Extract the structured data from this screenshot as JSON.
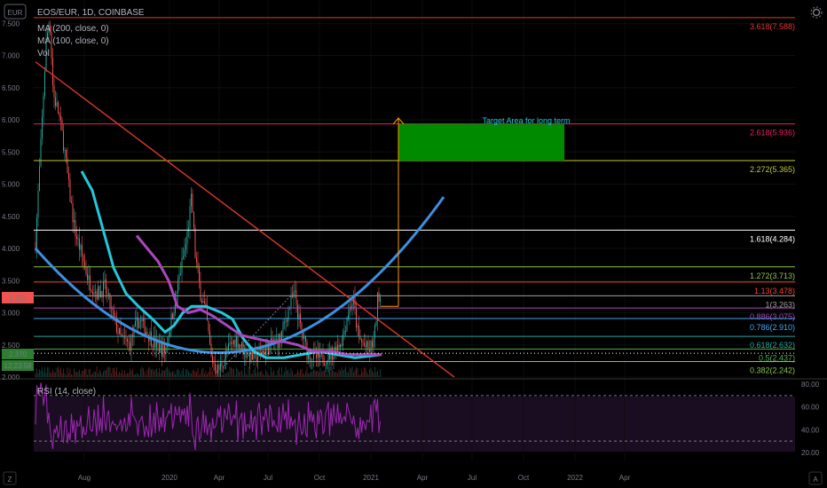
{
  "chart_data": {
    "type": "candlestick",
    "symbol_label": "EOS/EUR, 1D, COINBASE",
    "currency_badge": "EUR",
    "indicators": [
      "MA (200, close, 0)",
      "MA (100, close, 0)",
      "Vol"
    ],
    "rsi_label": "RSI (14, close)",
    "current_price": "3.258",
    "price_tag_2": "2.370",
    "countdown": "12:23:58",
    "price_axis": {
      "ticks": [
        "7.500",
        "7.000",
        "6.500",
        "6.000",
        "5.500",
        "5.000",
        "4.500",
        "4.000",
        "3.500",
        "3.000",
        "2.500",
        "2.000"
      ],
      "values": [
        7.5,
        7.0,
        6.5,
        6.0,
        5.5,
        5.0,
        4.5,
        4.0,
        3.5,
        3.0,
        2.5,
        2.0
      ],
      "ylim": [
        2.0,
        7.5
      ]
    },
    "rsi_axis": {
      "ticks": [
        "80.00",
        "60.00",
        "40.00",
        "20.00"
      ],
      "values": [
        80,
        60,
        40,
        20
      ],
      "ylim": [
        20,
        80
      ],
      "bands": [
        70,
        30
      ]
    },
    "time_axis": [
      "Aug",
      "2020",
      "Apr",
      "Jul",
      "Oct",
      "2021",
      "Apr",
      "Jul",
      "Oct",
      "2022",
      "Apr"
    ],
    "fib_levels": [
      {
        "label": "3.618(7.588)",
        "value": 7.588,
        "color": "#e0362f"
      },
      {
        "label": "2.618(5.936)",
        "value": 5.936,
        "color": "#e91e63"
      },
      {
        "label": "2.272(5.365)",
        "value": 5.365,
        "color": "#c0ca33"
      },
      {
        "label": "1.618(4.284)",
        "value": 4.284,
        "color": "#ffffff"
      },
      {
        "label": "1.272(3.713)",
        "value": 3.713,
        "color": "#8bc34a"
      },
      {
        "label": "1.13(3.478)",
        "value": 3.478,
        "color": "#f44336"
      },
      {
        "label": "1(3.263)",
        "value": 3.263,
        "color": "#9e9e9e"
      },
      {
        "label": "0.886(3.075)",
        "value": 3.075,
        "color": "#ab47bc"
      },
      {
        "label": "0.786(2.910)",
        "value": 2.91,
        "color": "#42a5f5"
      },
      {
        "label": "0.618(2.632)",
        "value": 2.632,
        "color": "#26a69a"
      },
      {
        "label": "0.5(2.437)",
        "value": 2.437,
        "color": "#4caf50"
      },
      {
        "label": "0.382(2.242)",
        "value": 2.242,
        "color": "#8bc34a"
      }
    ],
    "target_label": "Target Area for long term",
    "target_zone": {
      "low": 5.365,
      "high": 5.936
    },
    "colors": {
      "up": "#26a69a",
      "down": "#ef5350",
      "ma_cyan": "#26c6da",
      "ma_purple": "#ab47bc",
      "trend_blue": "#3d8fe0",
      "downtrend": "#e0362f",
      "arrow": "#ff9800",
      "rsi_line": "#9c27b0"
    }
  },
  "toolbar": {
    "settings_icon": "gear-icon",
    "scale_auto": "A",
    "scale_log": "Z"
  }
}
